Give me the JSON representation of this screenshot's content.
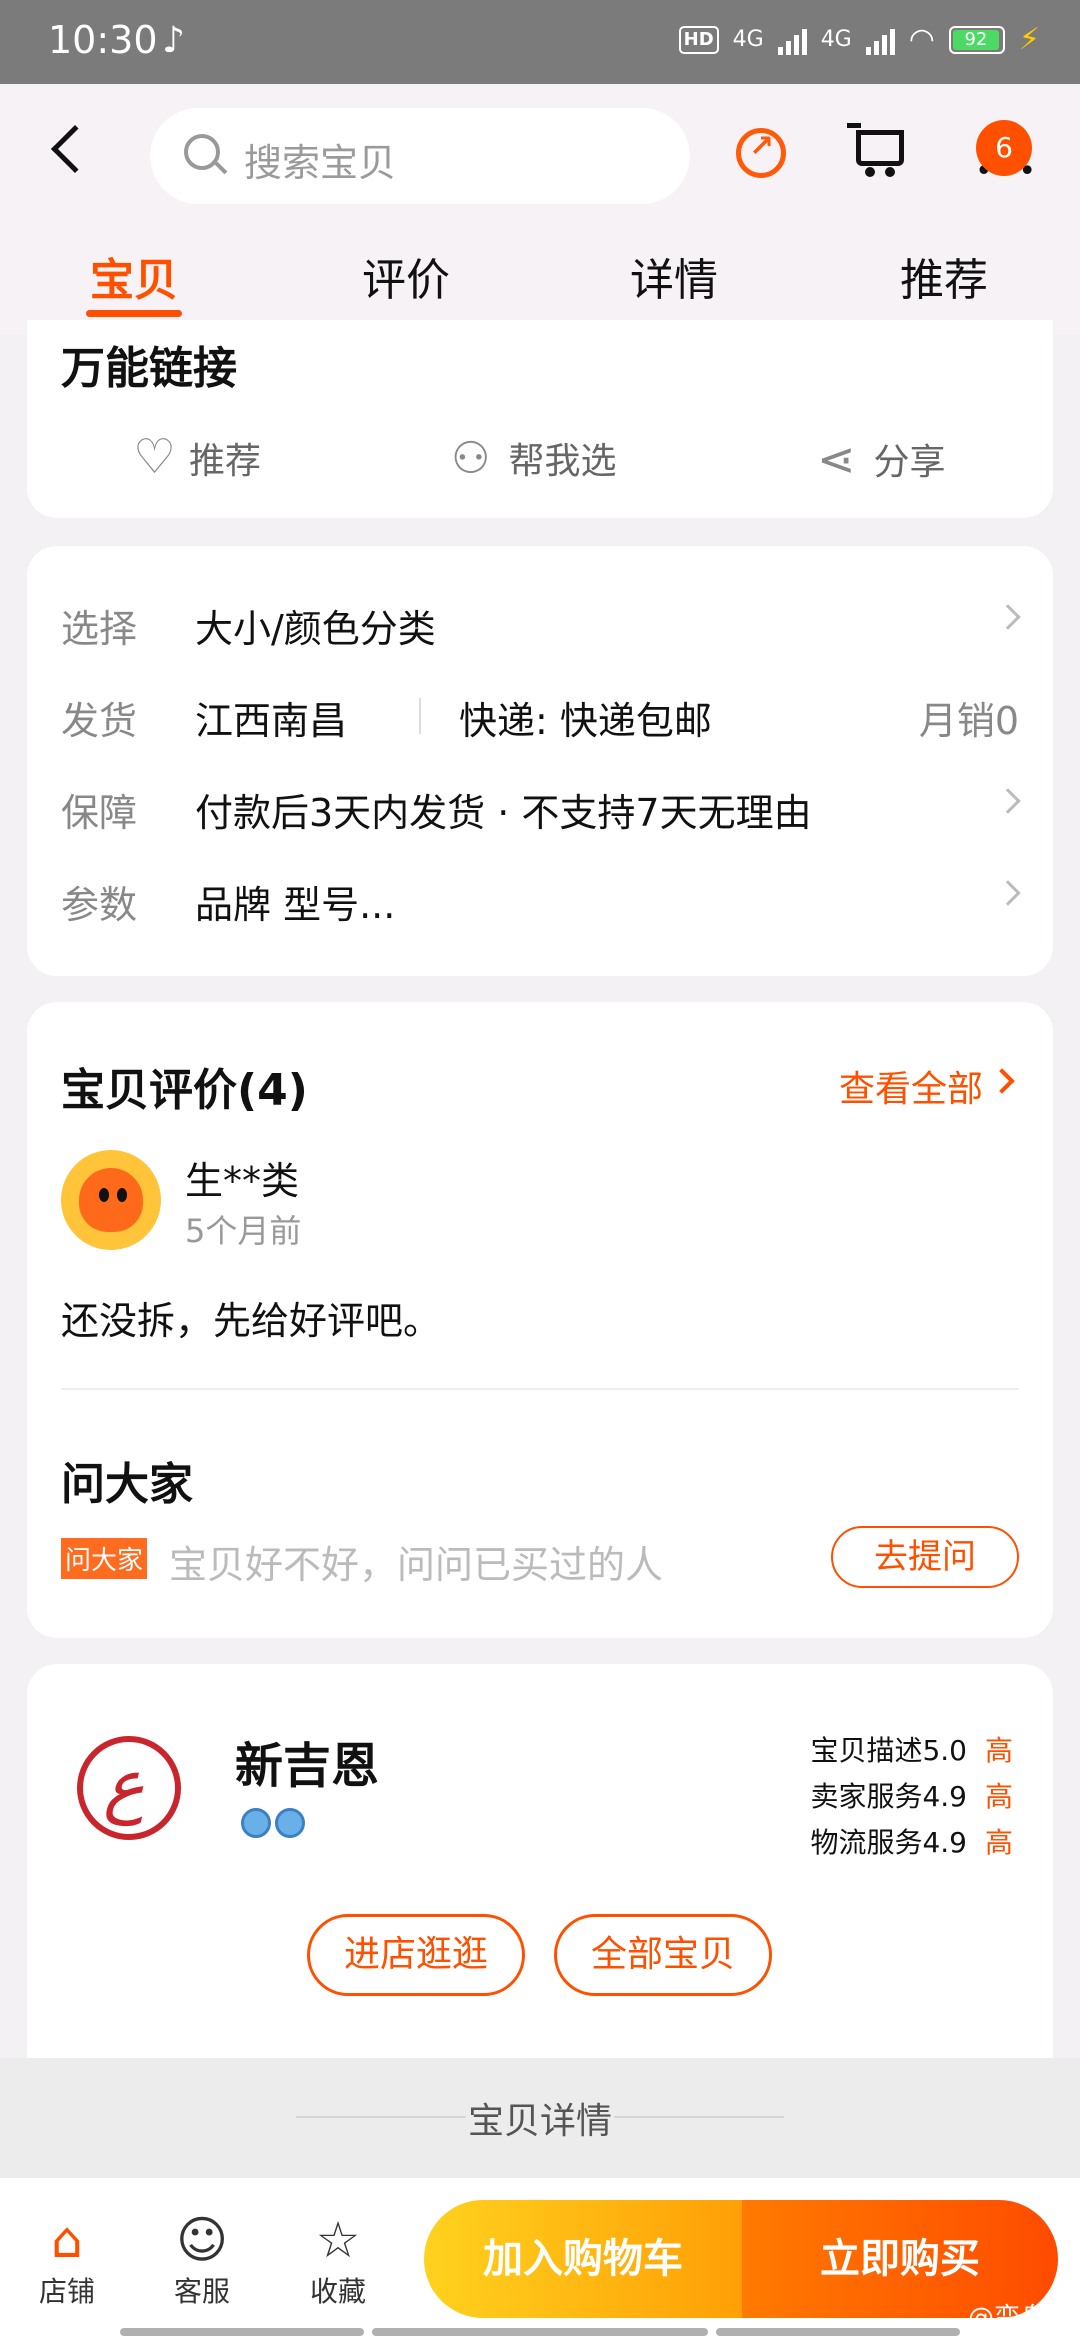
{
  "status": {
    "time": "10:30",
    "battery": "92"
  },
  "search": {
    "placeholder": "搜索宝贝"
  },
  "header": {
    "badge_count": "6"
  },
  "tabs": [
    "宝贝",
    "评价",
    "详情",
    "推荐"
  ],
  "product": {
    "title": "万能链接",
    "actions": [
      "推荐",
      "帮我选",
      "分享"
    ]
  },
  "info": {
    "choose": {
      "label": "选择",
      "value": "大小/颜色分类"
    },
    "ship": {
      "label": "发货",
      "origin": "江西南昌",
      "express": "快递: 快递包邮",
      "monthly": "月销0"
    },
    "guarantee": {
      "label": "保障",
      "value": "付款后3天内发货 · 不支持7天无理由"
    },
    "params": {
      "label": "参数",
      "value": "品牌 型号..."
    }
  },
  "reviews": {
    "title": "宝贝评价(4)",
    "view_all": "查看全部",
    "user": "生**类",
    "time_ago": "5个月前",
    "text": "还没拆，先给好评吧。"
  },
  "ask": {
    "title": "问大家",
    "tag": "问大家",
    "placeholder": "宝贝好不好，问问已买过的人",
    "button": "去提问"
  },
  "shop": {
    "name": "新吉恩",
    "scores": [
      {
        "label": "宝贝描述",
        "score": "5.0",
        "level": "高"
      },
      {
        "label": "卖家服务",
        "score": "4.9",
        "level": "高"
      },
      {
        "label": "物流服务",
        "score": "4.9",
        "level": "高"
      }
    ],
    "enter_button": "进店逛逛",
    "all_button": "全部宝贝"
  },
  "detail_label": "宝贝详情",
  "bottom": {
    "shop": "店铺",
    "service": "客服",
    "favorite": "收藏",
    "add_cart": "加入购物车",
    "buy_now": "立即购买"
  },
  "watermark": "@变身器",
  "colors": {
    "accent": "#ff5000",
    "cart_btn": "#ffb412",
    "buy_btn": "#ff5a00"
  }
}
